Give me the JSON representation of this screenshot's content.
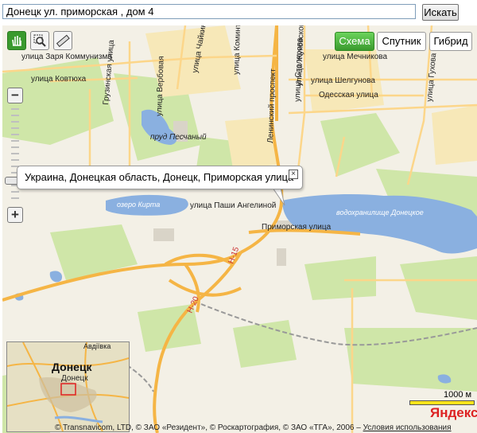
{
  "search": {
    "value": "Донецк ул. приморская , дом 4",
    "button": "Искать"
  },
  "tools": {
    "hand": "hand-icon",
    "zoom": "magnifier-icon",
    "ruler": "ruler-icon"
  },
  "modes": [
    "Схема",
    "Спутник",
    "Гибрид"
  ],
  "balloon": {
    "text": "Украина, Донецкая область, Донецк, Приморская улица"
  },
  "map_labels": {
    "street_zarya": "улица Заря Коммунизма",
    "street_kovtyukha": "улица Ковтюха",
    "street_gruzinskaya": "Грузинская улица",
    "street_verbova": "улица Вербовая",
    "street_chaikina": "улица Чайкиной",
    "street_kominterna": "улица Коминтерна",
    "street_leninsky": "Ленинский проспект",
    "street_zhukovskogo": "улица Жуковского",
    "street_stolyarova": "улица Столярова",
    "street_mechnikova": "улица Мечникова",
    "street_shelgunova": "улица Шелгунова",
    "street_odesskaya": "Одесская улица",
    "street_gukhova": "улица Гухова",
    "pond": "пруд Песчаный",
    "lake_kirta": "озеро Кирта",
    "street_pashi": "улица Паши Ангелиной",
    "street_primorskaya": "Приморская улица",
    "reservoir": "водохранилище Донецкое",
    "road_n15": "Н-15",
    "road_n20": "Н-20"
  },
  "minimap": {
    "city": "Донецк",
    "city_small": "Донецк",
    "district_avdeevka": "Авдіївка"
  },
  "scale": "1000 м",
  "logo": "Яндекс",
  "copyright": "© Transnavicom, LTD, © ЗАО «Резидент», © Роскартография, © ЗАО «ТГА», 2006 – ",
  "terms_link": "Условия использования"
}
